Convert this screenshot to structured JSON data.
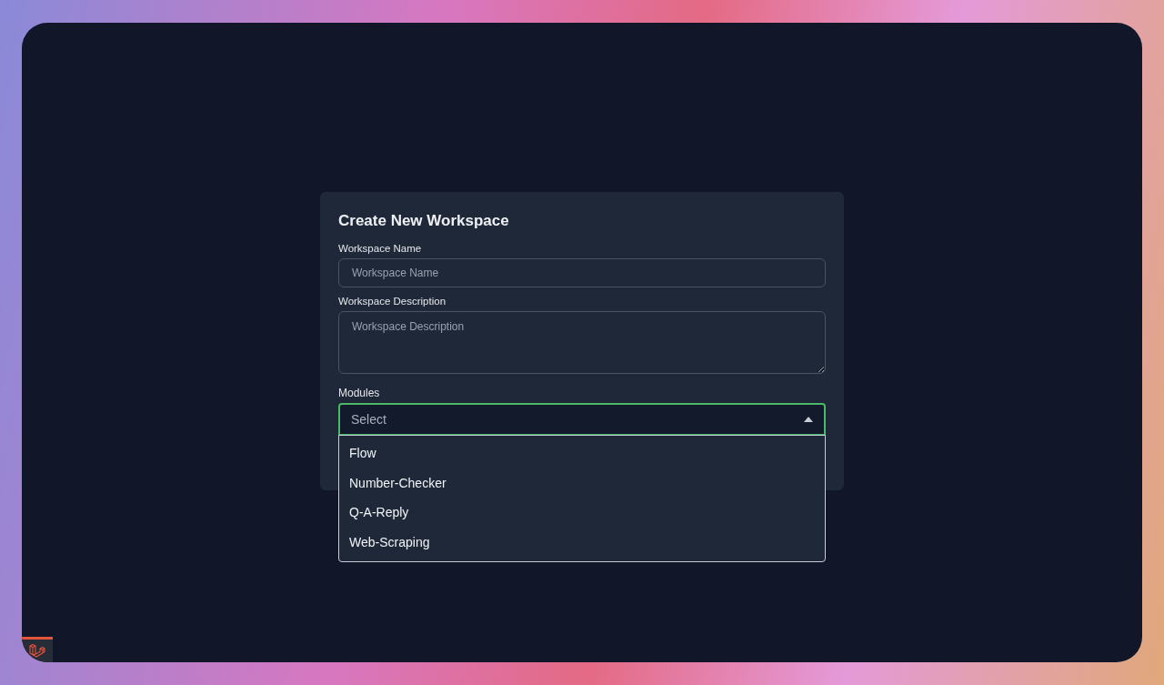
{
  "form": {
    "title": "Create New Workspace",
    "fields": [
      {
        "label": "Workspace Name",
        "placeholder": "Workspace Name",
        "kind": "input"
      },
      {
        "label": "Workspace Description",
        "placeholder": "Workspace Description",
        "kind": "textarea"
      }
    ],
    "modules": {
      "label": "Modules",
      "placeholder": "Select",
      "expanded": true,
      "options": [
        "Flow",
        "Number-Checker",
        "Q-A-Reply",
        "Web-Scraping"
      ]
    }
  }
}
